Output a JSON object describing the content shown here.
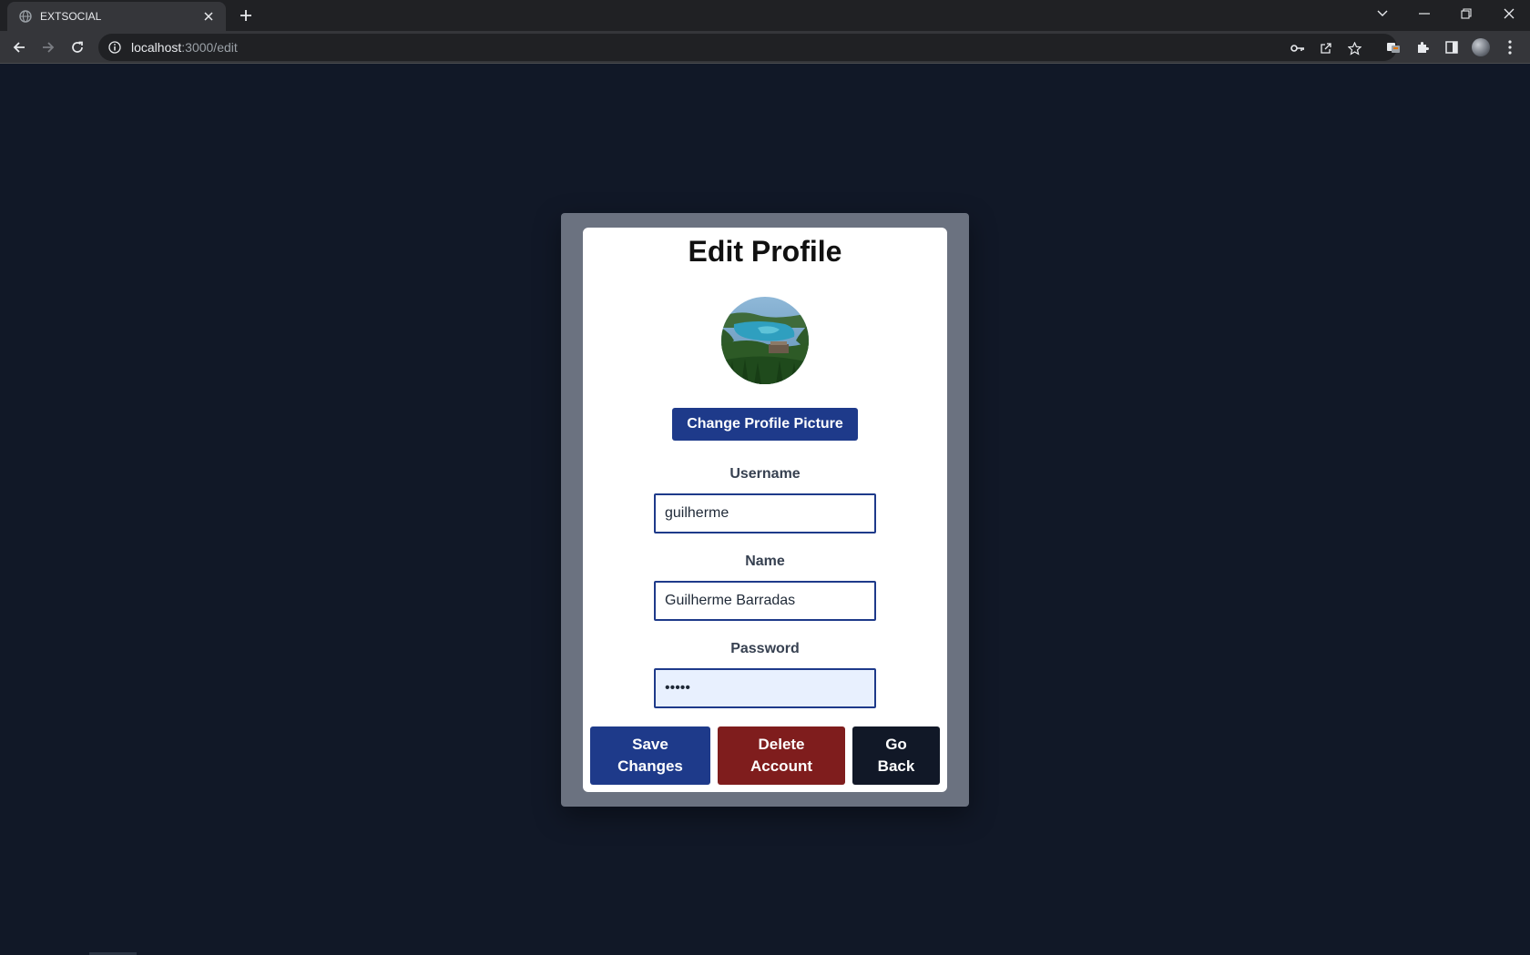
{
  "browser": {
    "tab_title": "EXTSOCIAL",
    "url_host": "localhost",
    "url_path": ":3000/edit"
  },
  "page": {
    "title": "Edit Profile",
    "change_picture_label": "Change Profile Picture",
    "username": {
      "label": "Username",
      "value": "guilherme"
    },
    "name": {
      "label": "Name",
      "value": "Guilherme Barradas"
    },
    "password": {
      "label": "Password",
      "value": "•••••"
    },
    "buttons": {
      "save_line1": "Save",
      "save_line2": "Changes",
      "delete_line1": "Delete",
      "delete_line2": "Account",
      "back_line1": "Go",
      "back_line2": "Back"
    }
  },
  "colors": {
    "page_background": "#111827",
    "card_frame": "#6b7280",
    "primary": "#1e3a8a",
    "danger": "#7f1d1d",
    "dark": "#111827"
  }
}
